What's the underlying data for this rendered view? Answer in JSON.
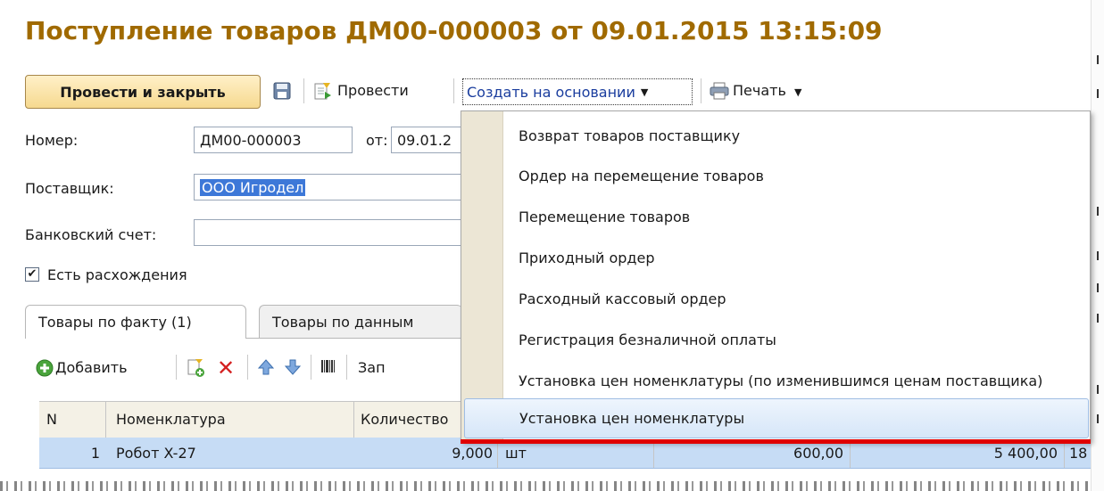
{
  "document": {
    "title": "Поступление товаров ДМ00-000003 от 09.01.2015 13:15:09"
  },
  "toolbar": {
    "post_and_close": "Провести и закрыть",
    "post": "Провести",
    "create_based_on": "Создать на основании",
    "print": "Печать"
  },
  "form": {
    "number_label": "Номер:",
    "number_value": "ДМ00-000003",
    "date_label": "от:",
    "date_value": "09.01.2",
    "supplier_label": "Поставщик:",
    "supplier_value": "ООО Игродел",
    "bank_account_label": "Банковский счет:",
    "bank_account_value": "",
    "discrepancy_label": "Есть расхождения",
    "discrepancy_checked": true
  },
  "tabs": [
    {
      "label": "Товары по факту (1)",
      "active": true
    },
    {
      "label": "Товары по данным",
      "active": false
    }
  ],
  "table_toolbar": {
    "add": "Добавить",
    "fill": "Зап"
  },
  "table": {
    "columns": [
      "N",
      "Номенклатура",
      "Количество"
    ],
    "rows": [
      {
        "n": "1",
        "item": "Робот X-27",
        "qty": "9,000",
        "unit": "шт",
        "price": "600,00",
        "sum": "5 400,00",
        "vat": "18"
      }
    ]
  },
  "context_menu": {
    "items": [
      "Возврат товаров поставщику",
      "Ордер на перемещение товаров",
      "Перемещение товаров",
      "Приходный ордер",
      "Расходный кассовый ордер",
      "Регистрация безналичной оплаты",
      "Установка цен номенклатуры (по изменившимся ценам поставщика)",
      "Установка цен номенклатуры"
    ],
    "highlighted_index": 7
  },
  "colors": {
    "title": "#a06a00",
    "highlight_underline": "#e00000",
    "selected_row": "#c6dcf5",
    "menu_highlight": "#d6e6f8"
  }
}
